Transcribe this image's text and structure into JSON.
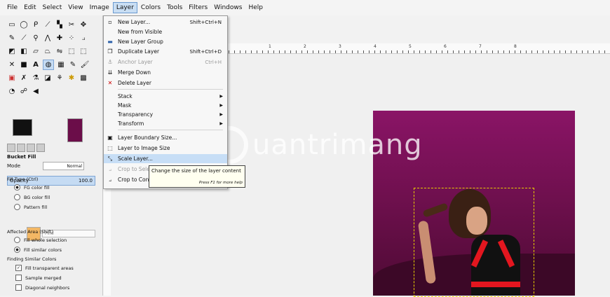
{
  "menubar": [
    "File",
    "Edit",
    "Select",
    "View",
    "Image",
    "Layer",
    "Colors",
    "Tools",
    "Filters",
    "Windows",
    "Help"
  ],
  "active_menu": "Layer",
  "layer_menu": {
    "new_layer": {
      "label": "New Layer...",
      "shortcut": "Shift+Ctrl+N"
    },
    "new_from_visible": {
      "label": "New from Visible"
    },
    "new_layer_group": {
      "label": "New Layer Group"
    },
    "duplicate_layer": {
      "label": "Duplicate Layer",
      "shortcut": "Shift+Ctrl+D"
    },
    "anchor_layer": {
      "label": "Anchor Layer",
      "shortcut": "Ctrl+H"
    },
    "merge_down": {
      "label": "Merge Down"
    },
    "delete_layer": {
      "label": "Delete Layer"
    },
    "stack": {
      "label": "Stack"
    },
    "mask": {
      "label": "Mask"
    },
    "transparency": {
      "label": "Transparency"
    },
    "transform": {
      "label": "Transform"
    },
    "layer_boundary_size": {
      "label": "Layer Boundary Size..."
    },
    "layer_to_image_size": {
      "label": "Layer to Image Size"
    },
    "scale_layer": {
      "label": "Scale Layer..."
    },
    "crop_to_selection": {
      "label": "Crop to Sele"
    },
    "crop_to_content": {
      "label": "Crop to Con"
    }
  },
  "tooltip": {
    "text": "Change the size of the layer content",
    "help": "Press F1 for more help"
  },
  "tool_options": {
    "title": "Bucket Fill",
    "mode_label": "Mode",
    "mode_value": "Normal",
    "opacity_label": "Opacity",
    "opacity_value": "100.0",
    "fill_type_label": "Fill Type  (Ctrl)",
    "fg_fill": "FG color fill",
    "bg_fill": "BG color fill",
    "pattern_fill": "Pattern fill",
    "pattern_name": "Pine",
    "affected_area_label": "Affected Area  (Shift)",
    "fill_whole_selection": "Fill whole selection",
    "fill_similar_colors": "Fill similar colors",
    "finding_similar_label": "Finding Similar Colors",
    "fill_transparent": "Fill transparent areas",
    "sample_merged": "Sample merged",
    "diagonal_neighbors": "Diagonal neighbors"
  },
  "ruler_labels": [
    "1",
    "2",
    "3",
    "4",
    "5",
    "6",
    "7",
    "8"
  ],
  "watermark": "uantrimang"
}
